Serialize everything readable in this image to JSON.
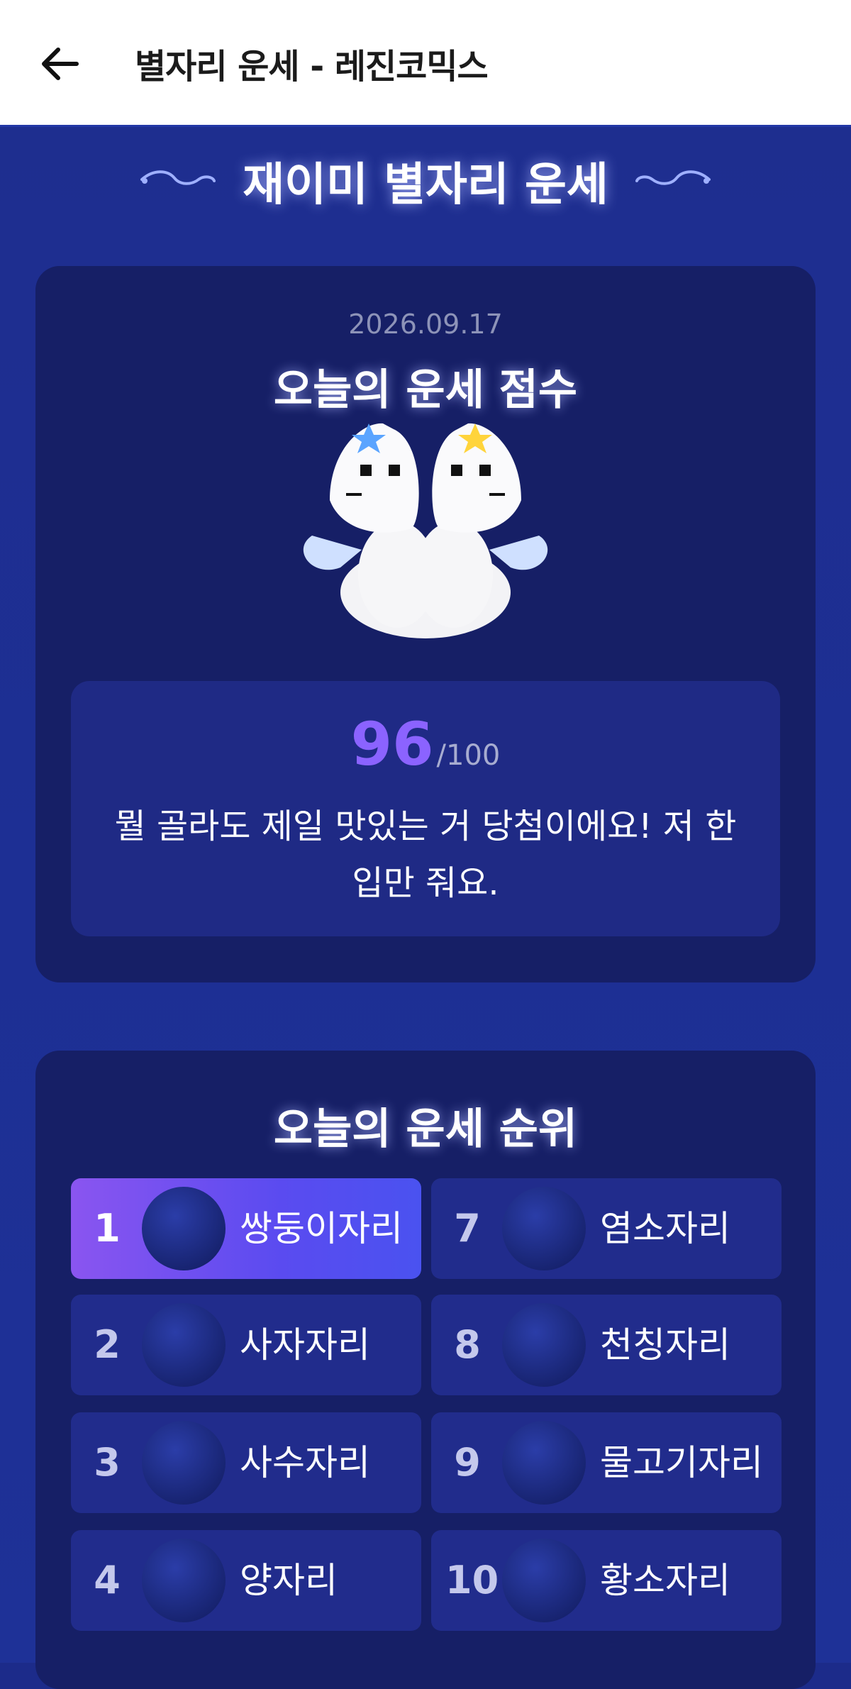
{
  "appbar": {
    "title": "별자리 운세 - 레진코믹스"
  },
  "page": {
    "title": "재이미 별자리 운세"
  },
  "fortune": {
    "date": "2026.09.17",
    "title": "오늘의 운세 점수",
    "score": "96",
    "score_max": "/100",
    "message": "뭘 골라도 제일 맛있는 거 당첨이에요! 저 한 입만 줘요."
  },
  "ranking": {
    "title": "오늘의 운세 순위",
    "items": [
      {
        "rank": "1",
        "name": "쌍둥이자리",
        "icon": "gemini-mascot-icon"
      },
      {
        "rank": "2",
        "name": "사자자리",
        "icon": "leo-mascot-icon"
      },
      {
        "rank": "3",
        "name": "사수자리",
        "icon": "sagittarius-mascot-icon"
      },
      {
        "rank": "4",
        "name": "양자리",
        "icon": "aries-mascot-icon"
      },
      {
        "rank": "7",
        "name": "염소자리",
        "icon": "capricorn-mascot-icon"
      },
      {
        "rank": "8",
        "name": "천칭자리",
        "icon": "libra-mascot-icon"
      },
      {
        "rank": "9",
        "name": "물고기자리",
        "icon": "pisces-mascot-icon"
      },
      {
        "rank": "10",
        "name": "황소자리",
        "icon": "taurus-mascot-icon"
      }
    ]
  },
  "colors": {
    "background": "#1c2b8a",
    "card": "#161f66",
    "accent_purple": "#8b63ff",
    "highlight_gradient_start": "#8a55f0",
    "highlight_gradient_end": "#4a52f0"
  }
}
